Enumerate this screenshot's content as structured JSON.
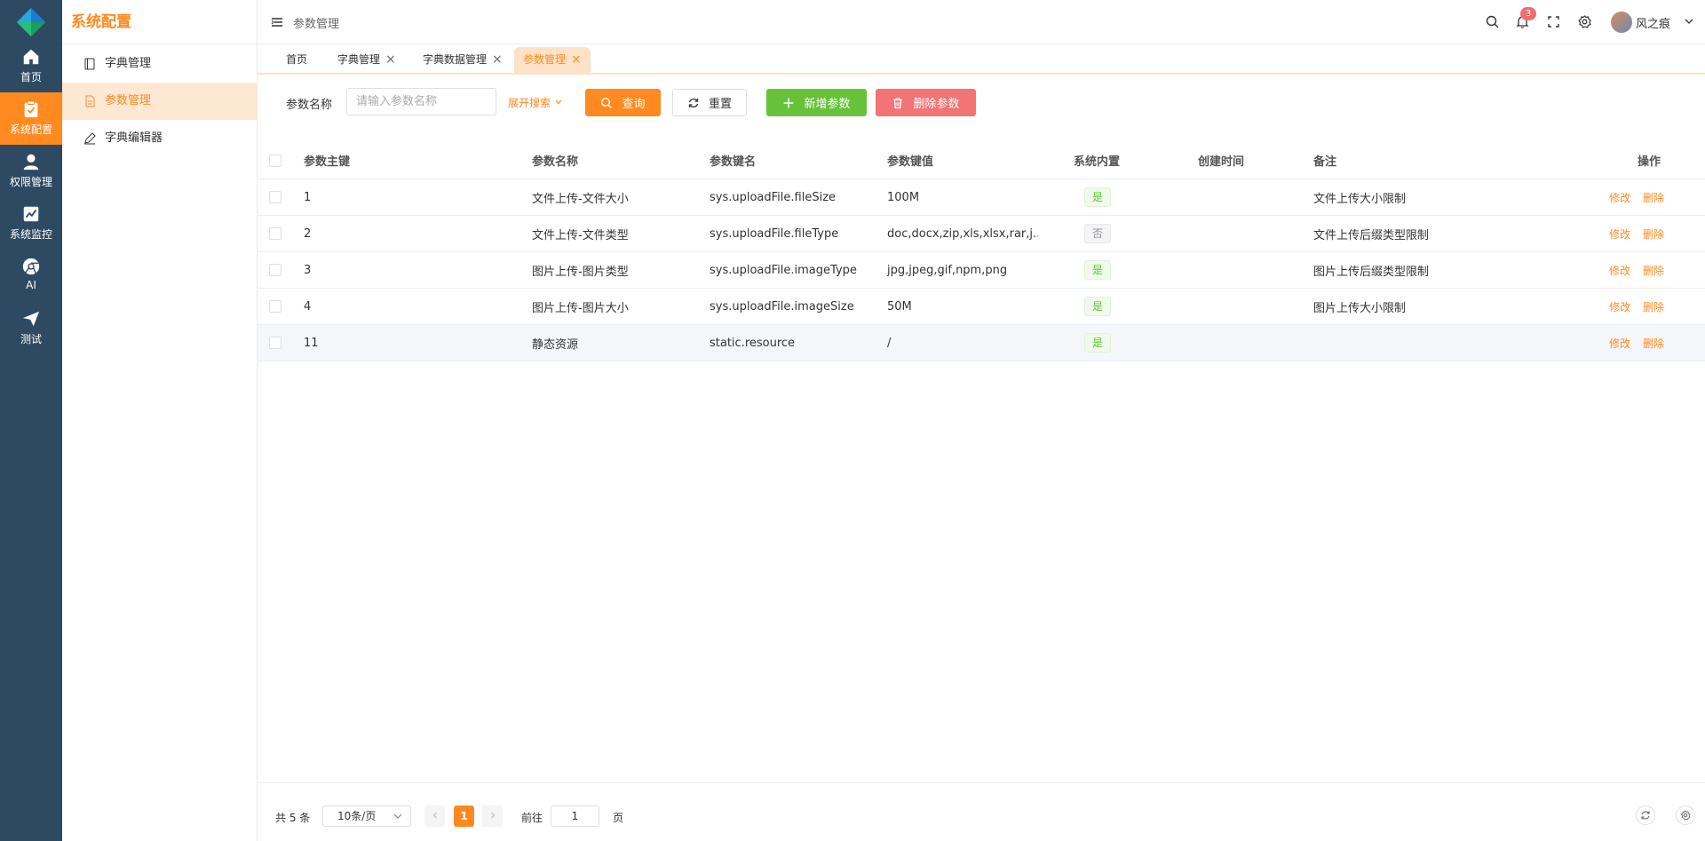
{
  "rail": {
    "items": [
      {
        "label": "首页",
        "icon": "home-icon"
      },
      {
        "label": "系统配置",
        "icon": "clipboard-check-icon"
      },
      {
        "label": "权限管理",
        "icon": "user-icon"
      },
      {
        "label": "系统监控",
        "icon": "line-chart-icon"
      },
      {
        "label": "AI",
        "icon": "chrome-icon"
      },
      {
        "label": "测试",
        "icon": "paper-plane-icon"
      }
    ],
    "active_index": 1
  },
  "submenu": {
    "title": "系统配置",
    "items": [
      {
        "label": "字典管理",
        "icon": "book-icon"
      },
      {
        "label": "参数管理",
        "icon": "document-icon"
      },
      {
        "label": "字典编辑器",
        "icon": "edit-icon"
      }
    ],
    "active_index": 1
  },
  "header": {
    "breadcrumb": "参数管理",
    "notification_count": "3",
    "username": "风之痕"
  },
  "tabs": [
    {
      "label": "首页",
      "closable": false
    },
    {
      "label": "字典管理",
      "closable": true
    },
    {
      "label": "字典数据管理",
      "closable": true
    },
    {
      "label": "参数管理",
      "closable": true
    }
  ],
  "tab_close_glyph": "×",
  "search": {
    "label": "参数名称",
    "placeholder": "请输入参数名称",
    "expand_label": "展开搜索",
    "query_label": "查询",
    "reset_label": "重置",
    "add_label": "新增参数",
    "delete_label": "删除参数"
  },
  "table": {
    "columns": [
      "参数主键",
      "参数名称",
      "参数键名",
      "参数键值",
      "系统内置",
      "创建时间",
      "备注",
      "操作"
    ],
    "rows": [
      {
        "id": "1",
        "name": "文件上传-文件大小",
        "key": "sys.uploadFile.fileSize",
        "value": "100M",
        "builtin": "是",
        "created": "",
        "remark": "文件上传大小限制"
      },
      {
        "id": "2",
        "name": "文件上传-文件类型",
        "key": "sys.uploadFile.fileType",
        "value": "doc,docx,zip,xls,xlsx,rar,j...",
        "builtin": "否",
        "created": "",
        "remark": "文件上传后缀类型限制"
      },
      {
        "id": "3",
        "name": "图片上传-图片类型",
        "key": "sys.uploadFile.imageType",
        "value": "jpg,jpeg,gif,npm,png",
        "builtin": "是",
        "created": "",
        "remark": "图片上传后缀类型限制"
      },
      {
        "id": "4",
        "name": "图片上传-图片大小",
        "key": "sys.uploadFile.imageSize",
        "value": "50M",
        "builtin": "是",
        "created": "",
        "remark": "图片上传大小限制"
      },
      {
        "id": "11",
        "name": "静态资源",
        "key": "static.resource",
        "value": "/",
        "builtin": "是",
        "created": "",
        "remark": ""
      }
    ],
    "edit_label": "修改",
    "delete_label": "删除"
  },
  "pagination": {
    "total_text": "共 5 条",
    "page_size": "10条/页",
    "current_page": "1",
    "goto_label": "前往",
    "goto_value": "1",
    "page_suffix": "页"
  },
  "colors": {
    "accent": "#ff8a1f",
    "rail_bg": "#2e4a63",
    "success": "#67c23a",
    "danger": "#f27474"
  }
}
